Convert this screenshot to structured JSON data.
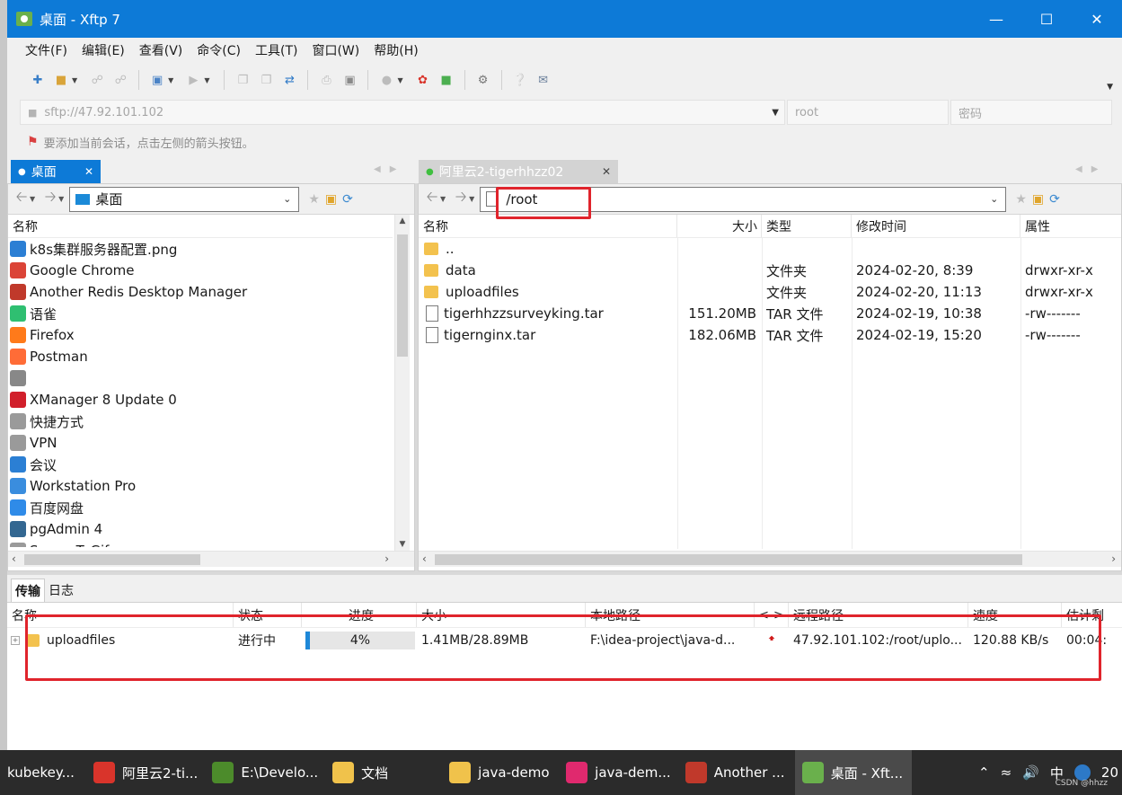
{
  "window": {
    "title": "桌面 - Xftp 7"
  },
  "menu": [
    "文件(F)",
    "编辑(E)",
    "查看(V)",
    "命令(C)",
    "工具(T)",
    "窗口(W)",
    "帮助(H)"
  ],
  "address": {
    "host": "sftp://47.92.101.102",
    "user_placeholder": "root",
    "pass_placeholder": "密码"
  },
  "hint": "要添加当前会话，点击左侧的箭头按钮。",
  "left": {
    "tab": "桌面",
    "path": "桌面",
    "header": "名称",
    "items": [
      {
        "name": "k8s集群服务器配置.png",
        "icon": "image-icon",
        "color": "#2b7fd4"
      },
      {
        "name": "Google Chrome",
        "icon": "chrome-icon",
        "color": "#db4437"
      },
      {
        "name": "Another Redis Desktop Manager",
        "icon": "redis-icon",
        "color": "#c0392b"
      },
      {
        "name": "语雀",
        "icon": "yuque-icon",
        "color": "#2fbf71"
      },
      {
        "name": "Firefox",
        "icon": "firefox-icon",
        "color": "#ff7a1a"
      },
      {
        "name": "Postman",
        "icon": "postman-icon",
        "color": "#ff6c37"
      },
      {
        "name": "",
        "icon": "app-icon",
        "color": "#888888"
      },
      {
        "name": "XManager 8 Update 0",
        "icon": "xmanager-icon",
        "color": "#d11f2b"
      },
      {
        "name": "快捷方式",
        "icon": "shortcut-icon",
        "color": "#9a9a9a"
      },
      {
        "name": "VPN",
        "icon": "vpn-icon",
        "color": "#9a9a9a"
      },
      {
        "name": "会议",
        "icon": "meeting-icon",
        "color": "#2b7fd4"
      },
      {
        "name": "Workstation Pro",
        "icon": "vmware-icon",
        "color": "#3a8dde"
      },
      {
        "name": "百度网盘",
        "icon": "baidu-icon",
        "color": "#2f8be8"
      },
      {
        "name": "pgAdmin 4",
        "icon": "pgadmin-icon",
        "color": "#336791"
      },
      {
        "name": "ScreenToGif.exe",
        "icon": "exe-icon",
        "color": "#9a9a9a"
      }
    ]
  },
  "right": {
    "tab": "阿里云2-tigerhhzz02",
    "path": "/root",
    "headers": [
      "名称",
      "大小",
      "类型",
      "修改时间",
      "属性"
    ],
    "items": [
      {
        "name": "..",
        "size": "",
        "type": "",
        "mtime": "",
        "attr": "",
        "kind": "folder"
      },
      {
        "name": "data",
        "size": "",
        "type": "文件夹",
        "mtime": "2024-02-20, 8:39",
        "attr": "drwxr-xr-x",
        "kind": "folder"
      },
      {
        "name": "uploadfiles",
        "size": "",
        "type": "文件夹",
        "mtime": "2024-02-20, 11:13",
        "attr": "drwxr-xr-x",
        "kind": "folder"
      },
      {
        "name": "tigerhhzzsurveyking.tar",
        "size": "151.20MB",
        "type": "TAR 文件",
        "mtime": "2024-02-19, 10:38",
        "attr": "-rw-------",
        "kind": "file"
      },
      {
        "name": "tigernginx.tar",
        "size": "182.06MB",
        "type": "TAR 文件",
        "mtime": "2024-02-19, 15:20",
        "attr": "-rw-------",
        "kind": "file"
      }
    ]
  },
  "transfer": {
    "tabs": [
      "传输",
      "日志"
    ],
    "headers": [
      "名称",
      "状态",
      "进度",
      "大小",
      "本地路径",
      "<->",
      "远程路径",
      "速度",
      "估计剩"
    ],
    "rows": [
      {
        "name": "uploadfiles",
        "status": "进行中",
        "progress": 4,
        "progress_label": "4%",
        "size": "1.41MB/28.89MB",
        "local": "F:\\idea-project\\java-d...",
        "remote": "47.92.101.102:/root/uplo...",
        "speed": "120.88 KB/s",
        "eta": "00:04:"
      }
    ]
  },
  "taskbar": {
    "items": [
      {
        "label": "kubekey...",
        "color": "#333333"
      },
      {
        "label": "阿里云2-ti...",
        "color": "#d9342b"
      },
      {
        "label": "E:\\Develo...",
        "color": "#4c8b2b"
      },
      {
        "label": "文档",
        "color": "#f0c24b"
      },
      {
        "label": "java-demo",
        "color": "#f0c24b"
      },
      {
        "label": "java-dem...",
        "color": "#e0296e"
      },
      {
        "label": "Another ...",
        "color": "#c0392b"
      },
      {
        "label": "桌面 - Xft...",
        "color": "#6ab04c"
      }
    ],
    "ime": "中",
    "watermark": "CSDN @hhzz",
    "clock": "20"
  }
}
